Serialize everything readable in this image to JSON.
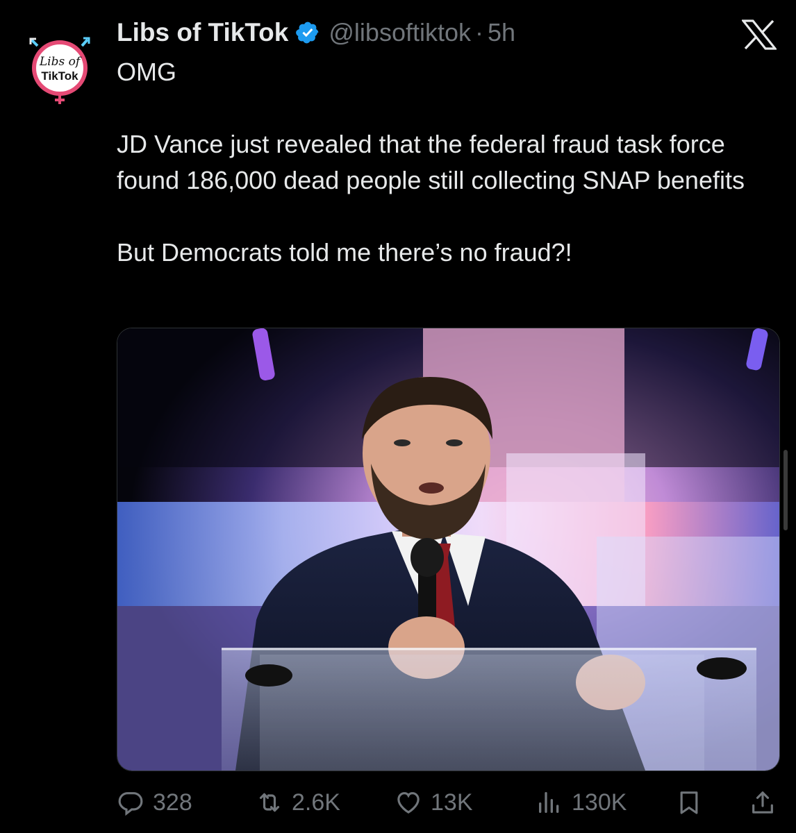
{
  "tweet": {
    "display_name": "Libs of TikTok",
    "handle": "@libsoftiktok",
    "separator": "·",
    "time": "5h",
    "avatar_text_line1": "Libs of",
    "avatar_text_line2": "TikTok",
    "text_lines": [
      "OMG",
      "",
      "JD Vance just revealed that the federal fraud task force found 186,000 dead people still collecting SNAP benefits",
      "",
      "But Democrats told me there’s no fraud?!"
    ],
    "text": {
      "line1": "OMG",
      "line2": "JD Vance just revealed that the federal fraud task force found 186,000 dead people still collecting SNAP benefits",
      "line3": "But Democrats told me there’s no fraud?!"
    },
    "media": {
      "kind": "photo",
      "subject": "man in a dark suit and red tie speaking into a microphone at a clear podium"
    },
    "stats": {
      "replies": "328",
      "reposts": "2.6K",
      "likes": "13K",
      "views": "130K"
    },
    "icons": {
      "reply": "reply-icon",
      "repost": "repost-icon",
      "like": "heart-icon",
      "views": "views-chart-icon",
      "bookmark": "bookmark-icon",
      "share": "share-icon",
      "verified": "verified-badge-icon",
      "platform": "x-logo-icon"
    },
    "colors": {
      "background": "#000000",
      "primary_text": "#e7e9ea",
      "secondary_text": "#71767b",
      "verified_blue": "#1d9bf0"
    }
  }
}
